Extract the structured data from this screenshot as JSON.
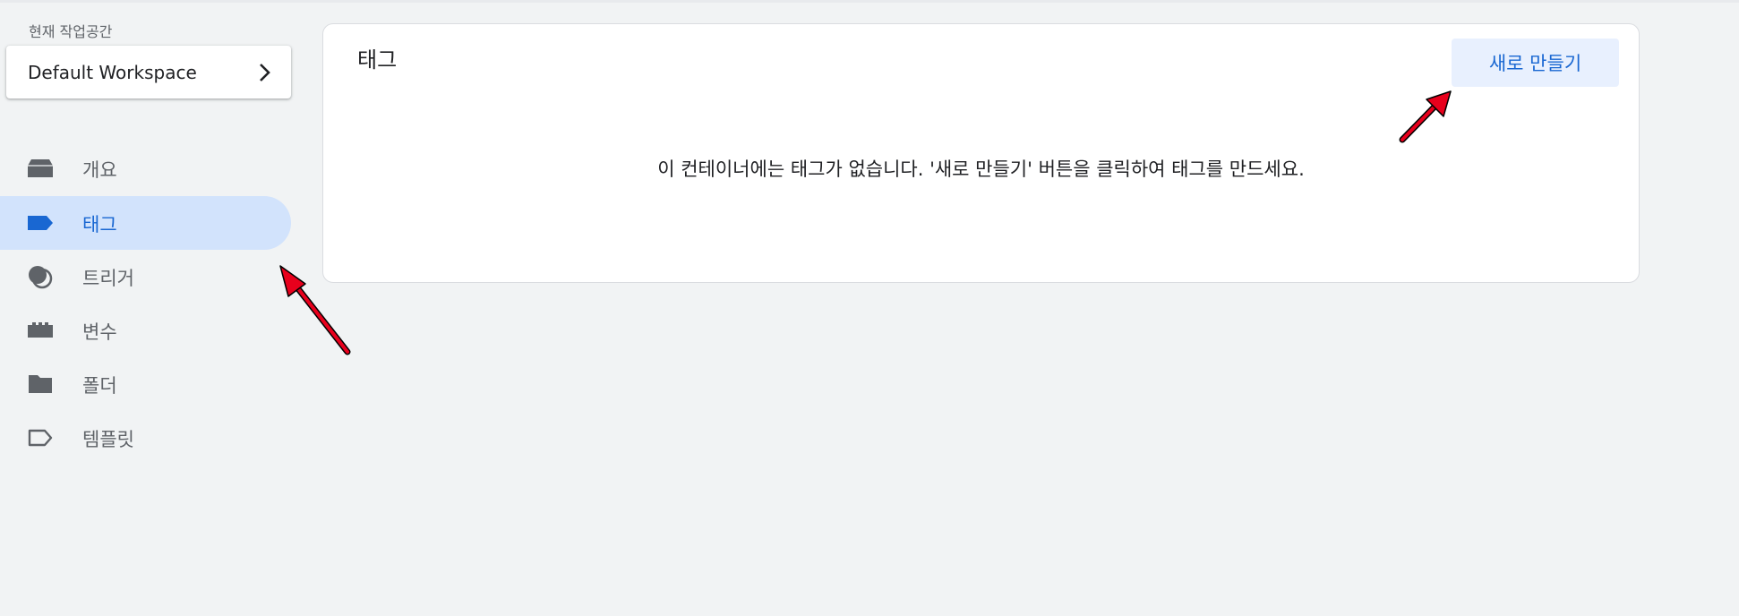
{
  "workspace": {
    "label": "현재 작업공간",
    "name": "Default Workspace"
  },
  "nav": {
    "items": [
      {
        "label": "개요",
        "icon": "overview-icon",
        "active": false
      },
      {
        "label": "태그",
        "icon": "tag-icon",
        "active": true
      },
      {
        "label": "트리거",
        "icon": "trigger-icon",
        "active": false
      },
      {
        "label": "변수",
        "icon": "variables-icon",
        "active": false
      },
      {
        "label": "폴더",
        "icon": "folder-icon",
        "active": false
      },
      {
        "label": "템플릿",
        "icon": "template-icon",
        "active": false
      }
    ]
  },
  "main": {
    "title": "태그",
    "new_button_label": "새로 만들기",
    "empty_message": "이 컨테이너에는 태그가 없습니다. '새로 만들기' 버튼을 클릭하여 태그를 만드세요."
  },
  "colors": {
    "accent": "#1967d2",
    "active_bg": "#d2e3fc",
    "button_bg": "#e8f0fe",
    "annotation_arrow": "#e8001c"
  }
}
